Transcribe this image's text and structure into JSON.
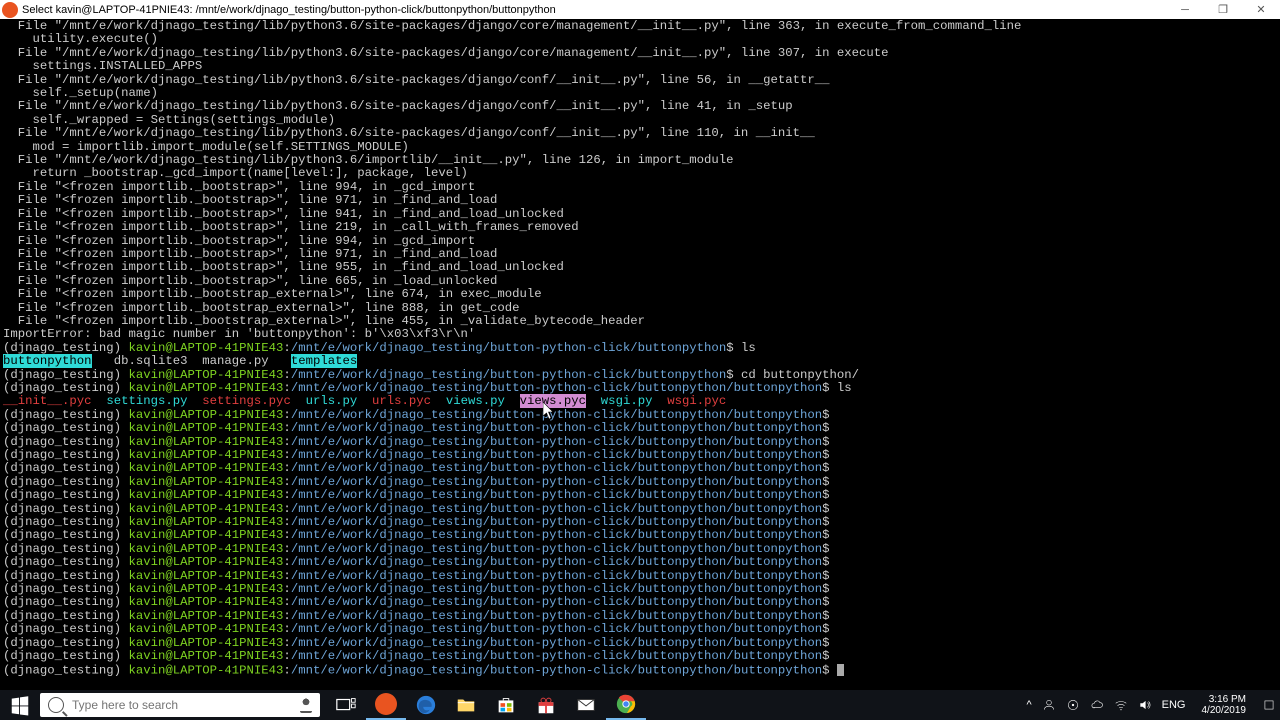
{
  "titlebar": {
    "title": "Select kavin@LAPTOP-41PNIE43: /mnt/e/work/djnago_testing/button-python-click/buttonpython/buttonpython"
  },
  "traceback": [
    "  File \"/mnt/e/work/djnago_testing/lib/python3.6/site-packages/django/core/management/__init__.py\", line 363, in execute_from_command_line",
    "    utility.execute()",
    "  File \"/mnt/e/work/djnago_testing/lib/python3.6/site-packages/django/core/management/__init__.py\", line 307, in execute",
    "    settings.INSTALLED_APPS",
    "  File \"/mnt/e/work/djnago_testing/lib/python3.6/site-packages/django/conf/__init__.py\", line 56, in __getattr__",
    "    self._setup(name)",
    "  File \"/mnt/e/work/djnago_testing/lib/python3.6/site-packages/django/conf/__init__.py\", line 41, in _setup",
    "    self._wrapped = Settings(settings_module)",
    "  File \"/mnt/e/work/djnago_testing/lib/python3.6/site-packages/django/conf/__init__.py\", line 110, in __init__",
    "    mod = importlib.import_module(self.SETTINGS_MODULE)",
    "  File \"/mnt/e/work/djnago_testing/lib/python3.6/importlib/__init__.py\", line 126, in import_module",
    "    return _bootstrap._gcd_import(name[level:], package, level)",
    "  File \"<frozen importlib._bootstrap>\", line 994, in _gcd_import",
    "  File \"<frozen importlib._bootstrap>\", line 971, in _find_and_load",
    "  File \"<frozen importlib._bootstrap>\", line 941, in _find_and_load_unlocked",
    "  File \"<frozen importlib._bootstrap>\", line 219, in _call_with_frames_removed",
    "  File \"<frozen importlib._bootstrap>\", line 994, in _gcd_import",
    "  File \"<frozen importlib._bootstrap>\", line 971, in _find_and_load",
    "  File \"<frozen importlib._bootstrap>\", line 955, in _find_and_load_unlocked",
    "  File \"<frozen importlib._bootstrap>\", line 665, in _load_unlocked",
    "  File \"<frozen importlib._bootstrap_external>\", line 674, in exec_module",
    "  File \"<frozen importlib._bootstrap_external>\", line 888, in get_code",
    "  File \"<frozen importlib._bootstrap_external>\", line 455, in _validate_bytecode_header",
    "ImportError: bad magic number in 'buttonpython': b'\\x03\\xf3\\r\\n'"
  ],
  "ps1": {
    "venv": "(djnago_testing) ",
    "userhost": "kavin@LAPTOP-41PNIE43",
    "sep": ":",
    "path1": "/mnt/e/work/djnago_testing/button-python-click/buttonpython",
    "path2": "/mnt/e/work/djnago_testing/button-python-click/buttonpython/buttonpython",
    "dollar": "$ "
  },
  "cmds": {
    "ls": "ls",
    "cd": "cd buttonpython/"
  },
  "ls1": {
    "dir1": "buttonpython",
    "file1": "   db.sqlite3  manage.py   ",
    "dir2": "templates"
  },
  "ls2": {
    "a": "__init__.pyc",
    "b": "  settings.py  ",
    "c": "settings.pyc",
    "d": "  urls.py  ",
    "e": "urls.pyc",
    "f": "  views.py  ",
    "g": "views.pyc",
    "h": "  wsgi.py  ",
    "i": "wsgi.pyc"
  },
  "repeat_count": 20,
  "search_placeholder": "Type here to search",
  "tray": {
    "lang": "ENG",
    "time": "3:16 PM",
    "date": "4/20/2019"
  }
}
